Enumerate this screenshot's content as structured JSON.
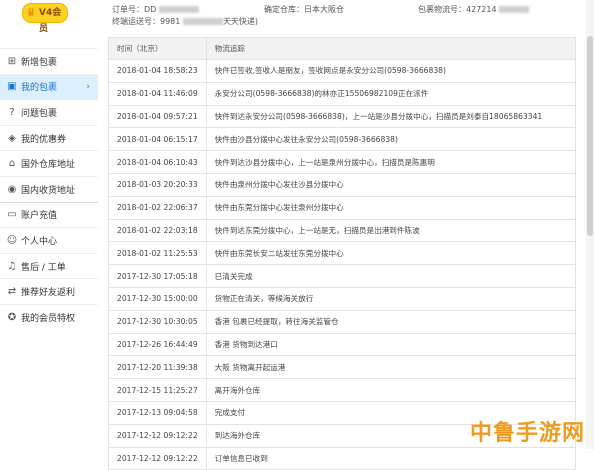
{
  "vip": {
    "level": "V4会员"
  },
  "header": {
    "order_label": "订单号：DD",
    "warehouse_label": "确定仓库：",
    "warehouse_value": "日本大阪仓",
    "tracking_label": "包裹物流号：",
    "tracking_value": "427214",
    "final_label": "终端运送号：",
    "final_value": "9981",
    "final_suffix": "天天快递)"
  },
  "sidebar": {
    "items": [
      {
        "label": "新增包裹",
        "icon": "plus-icon"
      },
      {
        "label": "我的包裹",
        "icon": "package-icon",
        "active": true
      },
      {
        "label": "问题包裹",
        "icon": "question-icon"
      },
      {
        "label": "我的优惠券",
        "icon": "coupon-icon"
      },
      {
        "label": "国外仓库地址",
        "icon": "warehouse-icon"
      },
      {
        "label": "国内收货地址",
        "icon": "location-icon"
      },
      {
        "label": "账户充值",
        "icon": "wallet-icon"
      },
      {
        "label": "个人中心",
        "icon": "user-icon"
      },
      {
        "label": "售后 / 工单",
        "icon": "headset-icon"
      },
      {
        "label": "推荐好友返利",
        "icon": "share-icon"
      },
      {
        "label": "我的会员特权",
        "icon": "badge-icon"
      }
    ]
  },
  "table": {
    "headers": [
      "时间（北京）",
      "物流追踪"
    ],
    "rows": [
      [
        "2018-01-04 18:58:23",
        "快件已签收,签收人是朋友，签收网点是永安分公司(0598-3666838)"
      ],
      [
        "2018-01-04 11:46:09",
        "永安分公司(0598-3666838)的林亦正15506982109正在派件"
      ],
      [
        "2018-01-04 09:57:21",
        "快件到达永安分公司(0598-3666838)，上一站是沙县分拨中心，扫描员是刘泰自18065863341"
      ],
      [
        "2018-01-04 06:15:17",
        "快件由沙县分拨中心发往永安分公司(0598-3666838)"
      ],
      [
        "2018-01-04 06:10:43",
        "快件到达沙县分拨中心，上一站是泉州分拨中心，扫描员是陈惠明"
      ],
      [
        "2018-01-03 20:20:33",
        "快件由泉州分拨中心发往沙县分拨中心"
      ],
      [
        "2018-01-02 22:06:37",
        "快件由东莞分拨中心发往泉州分拨中心"
      ],
      [
        "2018-01-02 22:03:18",
        "快件到达东莞分拨中心，上一站是无，扫描员是出港到件陈波"
      ],
      [
        "2018-01-02 11:25:53",
        "快件由东莞长安二站发往东莞分拨中心"
      ],
      [
        "2017-12-30 17:05:18",
        "已清关完成"
      ],
      [
        "2017-12-30 15:00:00",
        "货物正在清关，等候海关放行"
      ],
      [
        "2017-12-30 10:30:05",
        "香港 包裹已经提取，转往海关监管仓"
      ],
      [
        "2017-12-26 16:44:49",
        "香港 货物到达港口"
      ],
      [
        "2017-12-20 11:39:38",
        "大阪 货物离开起运港"
      ],
      [
        "2017-12-15 11:25:27",
        "离开海外仓库"
      ],
      [
        "2017-12-13 09:04:58",
        "完成支付"
      ],
      [
        "2017-12-12 09:12:22",
        "到达海外仓库"
      ],
      [
        "2017-12-12 09:12:22",
        "订单信息已收到"
      ]
    ]
  },
  "watermark": "中鲁手游网",
  "colors": {
    "accent": "#1677d2",
    "active_bg": "#dcefff",
    "vip": "#ffd21f",
    "watermark": "#f29a1f"
  }
}
